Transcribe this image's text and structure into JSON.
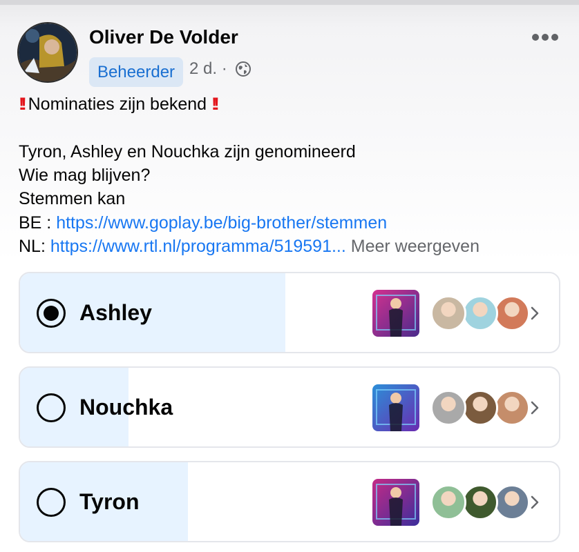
{
  "post": {
    "author": "Oliver De Volder",
    "role_badge": "Beheerder",
    "timestamp": "2 d. ·",
    "icons": {
      "privacy": "globe-icon",
      "menu": "more-horizontal-icon"
    },
    "lines": {
      "headline": "Nominaties zijn bekend",
      "emphasis_glyph": "‼️",
      "nominees": "Tyron, Ashley en Nouchka zijn genomineerd",
      "question": "Wie mag blijven?",
      "vote_intro": "Stemmen kan",
      "be_prefix": "BE :",
      "be_link": "https://www.goplay.be/big-brother/stemmen",
      "nl_prefix": "NL:",
      "nl_link": "https://www.rtl.nl/programma/519591...",
      "see_more": "Meer weergeven"
    }
  },
  "poll": {
    "options": [
      {
        "label": "Ashley",
        "selected": true,
        "share": 0.49,
        "thumb_colors": [
          "#d3318f",
          "#4a2b8c"
        ],
        "voter_colors": [
          "#c9b8a2",
          "#9fd3df",
          "#d27a5a"
        ]
      },
      {
        "label": "Nouchka",
        "selected": false,
        "share": 0.2,
        "thumb_colors": [
          "#2c8fd8",
          "#6a2bb0"
        ],
        "voter_colors": [
          "#a9a9a9",
          "#7b5b3e",
          "#c58d6a"
        ]
      },
      {
        "label": "Tyron",
        "selected": false,
        "share": 0.31,
        "thumb_colors": [
          "#c42a86",
          "#3b2e9c"
        ],
        "voter_colors": [
          "#8fbf96",
          "#3f5a2e",
          "#6c7f96"
        ]
      }
    ]
  },
  "colors": {
    "accent": "#1877f2",
    "fill": "#e7f3ff",
    "badge_bg": "#dbe7f5",
    "alert": "#e3141b"
  }
}
